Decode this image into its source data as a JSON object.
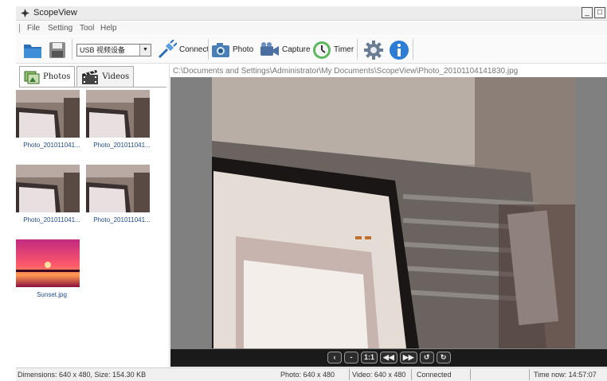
{
  "window": {
    "title": "ScopeView",
    "minimize_label": "_",
    "maximize_label": "□"
  },
  "menu": [
    "File",
    "Setting",
    "Tool",
    "Help"
  ],
  "toolbar": {
    "device": "USB 视频设备",
    "connect_label": "Connect",
    "photo_label": "Photo",
    "capture_label": "Capture",
    "timer_label": "Timer"
  },
  "tabs": {
    "photos": "Photos",
    "videos": "Videos"
  },
  "gallery": [
    {
      "caption": "Photo_201011041...",
      "kind": "monitor"
    },
    {
      "caption": "Photo_201011041...",
      "kind": "monitor"
    },
    {
      "caption": "Photo_201011041...",
      "kind": "monitor"
    },
    {
      "caption": "Photo_201011041...",
      "kind": "monitor"
    },
    {
      "caption": "Sunset.jpg",
      "kind": "sunset"
    }
  ],
  "viewer": {
    "path": "C:\\Documents and Settings\\Administrator\\My Documents\\ScopeView\\Photo_20101104141830.jpg",
    "controls": [
      "‹",
      "-",
      "1:1",
      "◀◀",
      "▶▶",
      "↺",
      "↻"
    ]
  },
  "status": {
    "dimensions": "Dimensions: 640 x 480, Size: 154.30 KB",
    "photo": "Photo: 640 x 480",
    "video": "Video: 640 x 480",
    "connection": "Connected",
    "time": "Time now: 14:57:07"
  }
}
